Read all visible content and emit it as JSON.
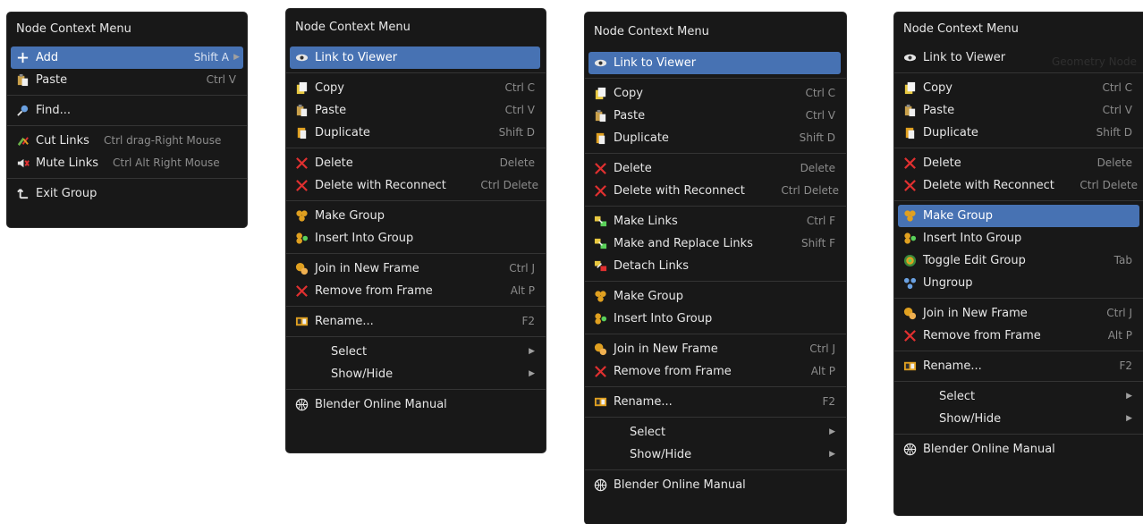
{
  "menu1": {
    "title": "Node Context Menu",
    "items": [
      {
        "label": "Add",
        "shortcut": "Shift A"
      },
      {
        "label": "Paste",
        "shortcut": "Ctrl V"
      },
      {
        "label": "Find...",
        "shortcut": ""
      },
      {
        "label": "Cut Links",
        "shortcut": "Ctrl drag-Right Mouse"
      },
      {
        "label": "Mute Links",
        "shortcut": "Ctrl Alt Right Mouse"
      },
      {
        "label": "Exit Group",
        "shortcut": ""
      }
    ]
  },
  "menu2": {
    "title": "Node Context Menu",
    "items": [
      {
        "label": "Link to Viewer",
        "shortcut": ""
      },
      {
        "label": "Copy",
        "shortcut": "Ctrl C"
      },
      {
        "label": "Paste",
        "shortcut": "Ctrl V"
      },
      {
        "label": "Duplicate",
        "shortcut": "Shift D"
      },
      {
        "label": "Delete",
        "shortcut": "Delete"
      },
      {
        "label": "Delete with Reconnect",
        "shortcut": "Ctrl Delete"
      },
      {
        "label": "Make Group",
        "shortcut": ""
      },
      {
        "label": "Insert Into Group",
        "shortcut": ""
      },
      {
        "label": "Join in New Frame",
        "shortcut": "Ctrl J"
      },
      {
        "label": "Remove from Frame",
        "shortcut": "Alt P"
      },
      {
        "label": "Rename...",
        "shortcut": "F2"
      },
      {
        "label": "Select",
        "shortcut": ""
      },
      {
        "label": "Show/Hide",
        "shortcut": ""
      },
      {
        "label": "Blender Online Manual",
        "shortcut": ""
      }
    ]
  },
  "menu3": {
    "title": "Node Context Menu",
    "items": [
      {
        "label": "Link to Viewer",
        "shortcut": ""
      },
      {
        "label": "Copy",
        "shortcut": "Ctrl C"
      },
      {
        "label": "Paste",
        "shortcut": "Ctrl V"
      },
      {
        "label": "Duplicate",
        "shortcut": "Shift D"
      },
      {
        "label": "Delete",
        "shortcut": "Delete"
      },
      {
        "label": "Delete with Reconnect",
        "shortcut": "Ctrl Delete"
      },
      {
        "label": "Make Links",
        "shortcut": "Ctrl F"
      },
      {
        "label": "Make and Replace Links",
        "shortcut": "Shift F"
      },
      {
        "label": "Detach Links",
        "shortcut": ""
      },
      {
        "label": "Make Group",
        "shortcut": ""
      },
      {
        "label": "Insert Into Group",
        "shortcut": ""
      },
      {
        "label": "Join in New Frame",
        "shortcut": "Ctrl J"
      },
      {
        "label": "Remove from Frame",
        "shortcut": "Alt P"
      },
      {
        "label": "Rename...",
        "shortcut": "F2"
      },
      {
        "label": "Select",
        "shortcut": ""
      },
      {
        "label": "Show/Hide",
        "shortcut": ""
      },
      {
        "label": "Blender Online Manual",
        "shortcut": ""
      }
    ]
  },
  "menu4": {
    "title": "Node Context Menu",
    "background_text": "Geometry Node",
    "items": [
      {
        "label": "Link to Viewer",
        "shortcut": ""
      },
      {
        "label": "Copy",
        "shortcut": "Ctrl C"
      },
      {
        "label": "Paste",
        "shortcut": "Ctrl V"
      },
      {
        "label": "Duplicate",
        "shortcut": "Shift D"
      },
      {
        "label": "Delete",
        "shortcut": "Delete"
      },
      {
        "label": "Delete with Reconnect",
        "shortcut": "Ctrl Delete"
      },
      {
        "label": "Make Group",
        "shortcut": ""
      },
      {
        "label": "Insert Into Group",
        "shortcut": ""
      },
      {
        "label": "Toggle Edit Group",
        "shortcut": "Tab"
      },
      {
        "label": "Ungroup",
        "shortcut": ""
      },
      {
        "label": "Join in New Frame",
        "shortcut": "Ctrl J"
      },
      {
        "label": "Remove from Frame",
        "shortcut": "Alt P"
      },
      {
        "label": "Rename...",
        "shortcut": "F2"
      },
      {
        "label": "Select",
        "shortcut": ""
      },
      {
        "label": "Show/Hide",
        "shortcut": ""
      },
      {
        "label": "Blender Online Manual",
        "shortcut": ""
      }
    ]
  },
  "colors": {
    "menu_bg": "#181818",
    "highlight": "#4772b3",
    "text": "#e6e6e6",
    "shortcut_text": "#8c8c8c",
    "delete_red": "#e03030"
  }
}
